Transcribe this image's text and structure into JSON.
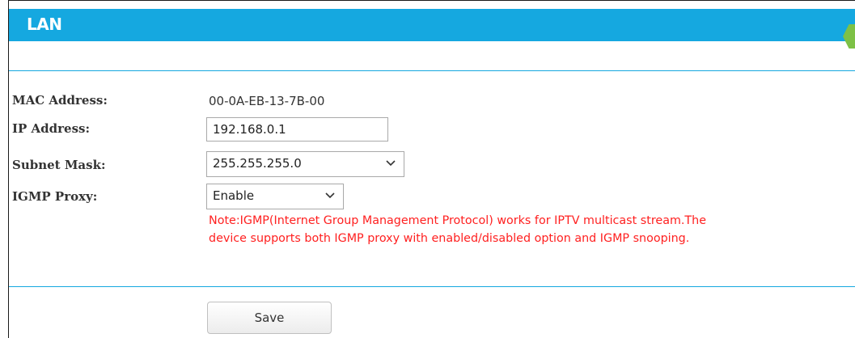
{
  "header": {
    "title": "LAN"
  },
  "fields": {
    "mac": {
      "label": "MAC Address:",
      "value": "00-0A-EB-13-7B-00"
    },
    "ip": {
      "label": "IP Address:",
      "value": "192.168.0.1"
    },
    "subnet": {
      "label": "Subnet Mask:",
      "value": "255.255.255.0"
    },
    "igmp": {
      "label": "IGMP Proxy:",
      "value": "Enable"
    }
  },
  "note": {
    "line1": "Note:IGMP(Internet Group Management Protocol) works for IPTV multicast stream.The",
    "line2": "device supports both IGMP proxy with enabled/disabled option and IGMP snooping."
  },
  "actions": {
    "save_label": "Save"
  },
  "colors": {
    "header": "#15a8e0",
    "note": "#ff2020",
    "accent_tab": "#7dc146"
  }
}
